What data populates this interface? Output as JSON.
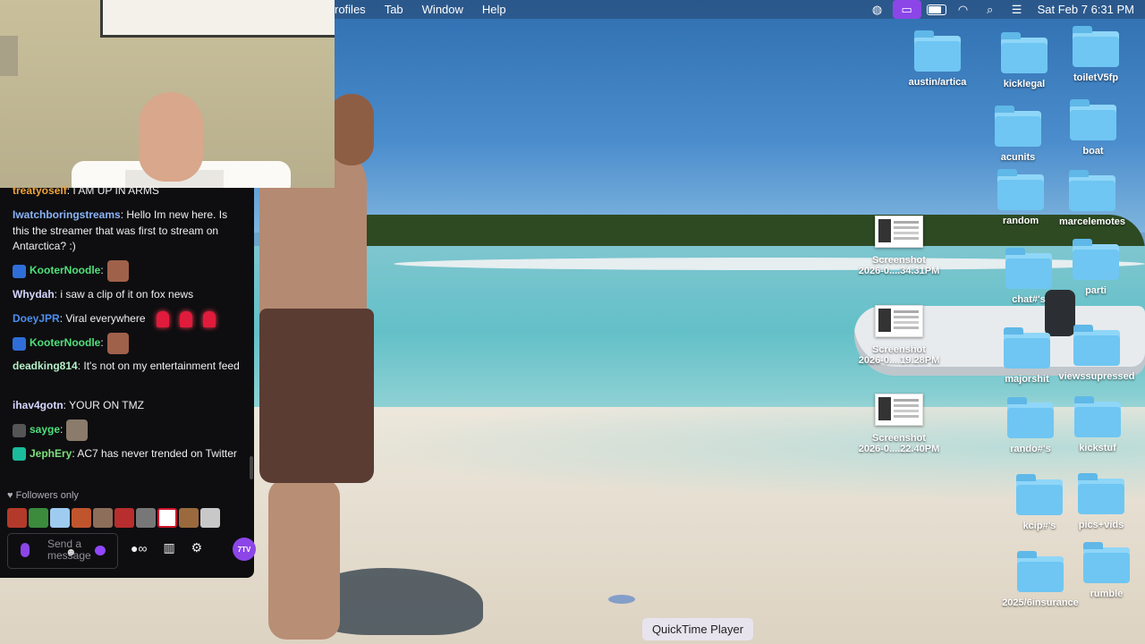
{
  "menubar": {
    "items": [
      "rofiles",
      "Tab",
      "Window",
      "Help"
    ],
    "clock": "Sat Feb 7  6:31 PM"
  },
  "desktop": {
    "icons": [
      {
        "name": "austin/artica",
        "kind": "folder"
      },
      {
        "name": "kicklegal",
        "kind": "folder"
      },
      {
        "name": "toiletV5fp",
        "kind": "folder"
      },
      {
        "name": "acunits",
        "kind": "folder"
      },
      {
        "name": "boat",
        "kind": "folder"
      },
      {
        "name": "random",
        "kind": "folder"
      },
      {
        "name": "marcelemotes",
        "kind": "folder"
      },
      {
        "name": "chat#'s",
        "kind": "folder"
      },
      {
        "name": "parti",
        "kind": "folder"
      },
      {
        "name": "majorshit",
        "kind": "folder"
      },
      {
        "name": "viewssupressed",
        "kind": "folder"
      },
      {
        "name": "rando#'s",
        "kind": "folder"
      },
      {
        "name": "kickstuf",
        "kind": "folder"
      },
      {
        "name": "kcip#'s",
        "kind": "folder"
      },
      {
        "name": "pics+vids",
        "kind": "folder"
      },
      {
        "name": "2025/6insurance",
        "kind": "folder"
      },
      {
        "name": "rumble",
        "kind": "folder"
      }
    ],
    "screenshots": [
      {
        "line1": "Screenshot",
        "line2": "2026-0....34.31PM"
      },
      {
        "line1": "Screenshot",
        "line2": "2026-0....19.28PM"
      },
      {
        "line1": "Screenshot",
        "line2": "2026-0....22.40PM"
      }
    ]
  },
  "chat": {
    "messages": [
      {
        "user": "treatyoself",
        "text": ": I AM UP IN ARMS",
        "color": "#f0a33a"
      },
      {
        "user": "Iwatchboringstreams",
        "text": ": Hello Im new here. Is this the streamer that was first to stream on Antarctica? :)",
        "color": "#8ab4f8"
      },
      {
        "user": "KooterNoodle",
        "text": ":",
        "color": "#4fe07b"
      },
      {
        "user": "Whydah",
        "text": ": i saw a clip of it on fox news",
        "color": "#d6d6ff"
      },
      {
        "user": "DoeyJPR",
        "text": ": Viral everywhere",
        "color": "#4d8ff2"
      },
      {
        "user": "KooterNoodle",
        "text": ":",
        "color": "#4fe07b"
      },
      {
        "user": "deadking814",
        "text": ": It's not on my entertainment feed",
        "color": "#b4f0c8"
      },
      {
        "user": "ihav4gotn",
        "text": ": YOUR ON TMZ",
        "color": "#d6d6ff"
      },
      {
        "user": "sayge",
        "text": ":",
        "color": "#4fe07b"
      },
      {
        "user": "JephEry",
        "text": ": AC7 has never trended on Twitter",
        "color": "#7be07b"
      }
    ],
    "followers_only": "Followers only",
    "input_placeholder": "Send a message",
    "tv_badge": "7TV"
  },
  "dock": {
    "tooltip": "QuickTime Player"
  },
  "colors": {
    "accent": "#8c46e8",
    "chat_bg": "#0e0e10",
    "folder": "#6fc6f2"
  }
}
